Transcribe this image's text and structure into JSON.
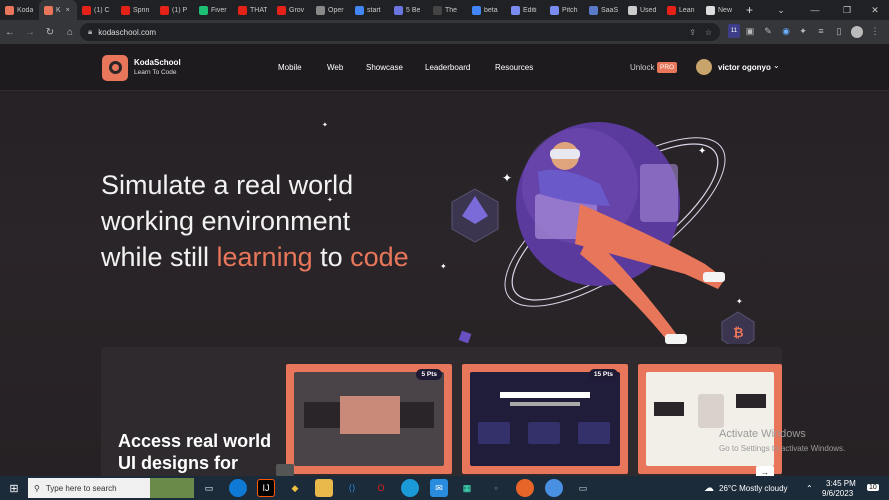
{
  "browser": {
    "tabs": [
      {
        "label": "Koda",
        "color": "#e8765a"
      },
      {
        "label": "K",
        "color": "#e8765a",
        "active": true
      },
      {
        "label": "(1) C",
        "color": "#e62117"
      },
      {
        "label": "Sprin",
        "color": "#e62117"
      },
      {
        "label": "(1) P",
        "color": "#e62117"
      },
      {
        "label": "Fiver",
        "color": "#1dbf73"
      },
      {
        "label": "THAT",
        "color": "#e62117"
      },
      {
        "label": "Grov",
        "color": "#e62117"
      },
      {
        "label": "Oper",
        "color": "#888888"
      },
      {
        "label": "start",
        "color": "#4285f4"
      },
      {
        "label": "5 Be",
        "color": "#6a75e0"
      },
      {
        "label": "The",
        "color": "#444444"
      },
      {
        "label": "beta",
        "color": "#4285f4"
      },
      {
        "label": "Editi",
        "color": "#7a8cf0"
      },
      {
        "label": "Pitch",
        "color": "#7a8cf0"
      },
      {
        "label": "SaaS",
        "color": "#5a7ac8"
      },
      {
        "label": "Used",
        "color": "#cccccc"
      },
      {
        "label": "Lean",
        "color": "#e62117"
      },
      {
        "label": "New",
        "color": "#dddddd"
      }
    ],
    "tab_close": "×",
    "new_tab": "+",
    "url": "kodaschool.com",
    "extension_badge": "11"
  },
  "header": {
    "brand": "KodaSchool",
    "brand_tagline": "Learn To Code",
    "nav": [
      "Mobile",
      "Web",
      "Showcase",
      "Leaderboard",
      "Resources"
    ],
    "unlock": "Unlock",
    "pro_badge": "PRO",
    "user_name": "victor ogonyo",
    "chevron": "⌄"
  },
  "hero": {
    "line1": "Simulate a real world",
    "line2": "working environment",
    "line3_a": "while still ",
    "line3_b": "learning",
    "line3_c": " to ",
    "line3_d": "code"
  },
  "section": {
    "title_line1": "Access real world",
    "title_line2": "UI designs for",
    "cards": [
      {
        "points": "5 Pts",
        "bg": "#4a4348"
      },
      {
        "points": "15 Pts",
        "bg": "#1f1d3a"
      },
      {
        "points": "",
        "bg": "#f2efe9"
      }
    ],
    "next_arrow": "→"
  },
  "windows": {
    "activate_title": "Activate Windows",
    "activate_sub": "Go to Settings to activate Windows.",
    "search_placeholder": "Type here to search",
    "weather": "26°C  Mostly cloudy",
    "time": "3:45 PM",
    "date": "9/6/2023",
    "notif_count": "10"
  },
  "colors": {
    "accent": "#e8765a",
    "page_bg": "#262124",
    "header_bg": "#1d1b1e",
    "planet": "#5b3a9e"
  }
}
